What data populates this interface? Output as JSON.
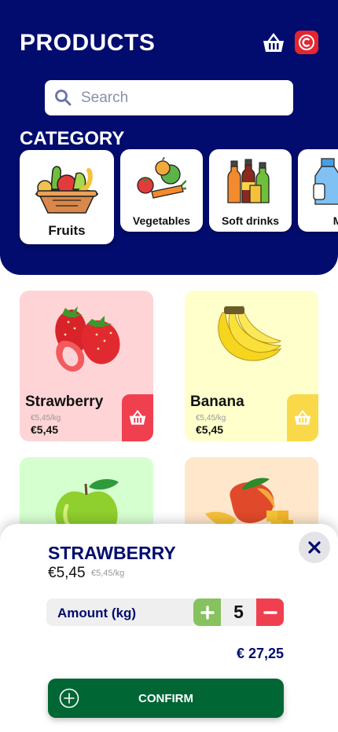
{
  "header": {
    "title": "PRODUCTS"
  },
  "search": {
    "placeholder": "Search"
  },
  "categories": {
    "title": "CATEGORY",
    "items": [
      {
        "label": "Fruits",
        "icon": "fruit-basket-icon"
      },
      {
        "label": "Vegetables",
        "icon": "vegetables-icon"
      },
      {
        "label": "Soft drinks",
        "icon": "soft-drinks-icon"
      },
      {
        "label": "Mi",
        "icon": "milk-icon"
      }
    ]
  },
  "products": [
    {
      "name": "Strawberry",
      "unit_price": "€5,45/kg",
      "price": "€5,45",
      "bg": "#ffd4d6",
      "btn": "#f04050"
    },
    {
      "name": "Banana",
      "unit_price": "€5,45/kg",
      "price": "€5,45",
      "bg": "#feffca",
      "btn": "#f9d84a"
    },
    {
      "name": "",
      "bg": "#d6ffd0"
    },
    {
      "name": "",
      "bg": "#ffe7cc"
    }
  ],
  "sheet": {
    "title": "STRAWBERRY",
    "price": "€5,45",
    "unit_price": "€5,45/kg",
    "amount_label": "Amount (kg)",
    "quantity": "5",
    "total": "€ 27,25",
    "confirm_label": "CONFIRM"
  },
  "colors": {
    "brand": "#020c6e",
    "accent_red": "#f04050",
    "confirm_green": "#006634",
    "plus_green": "#86c25e"
  }
}
